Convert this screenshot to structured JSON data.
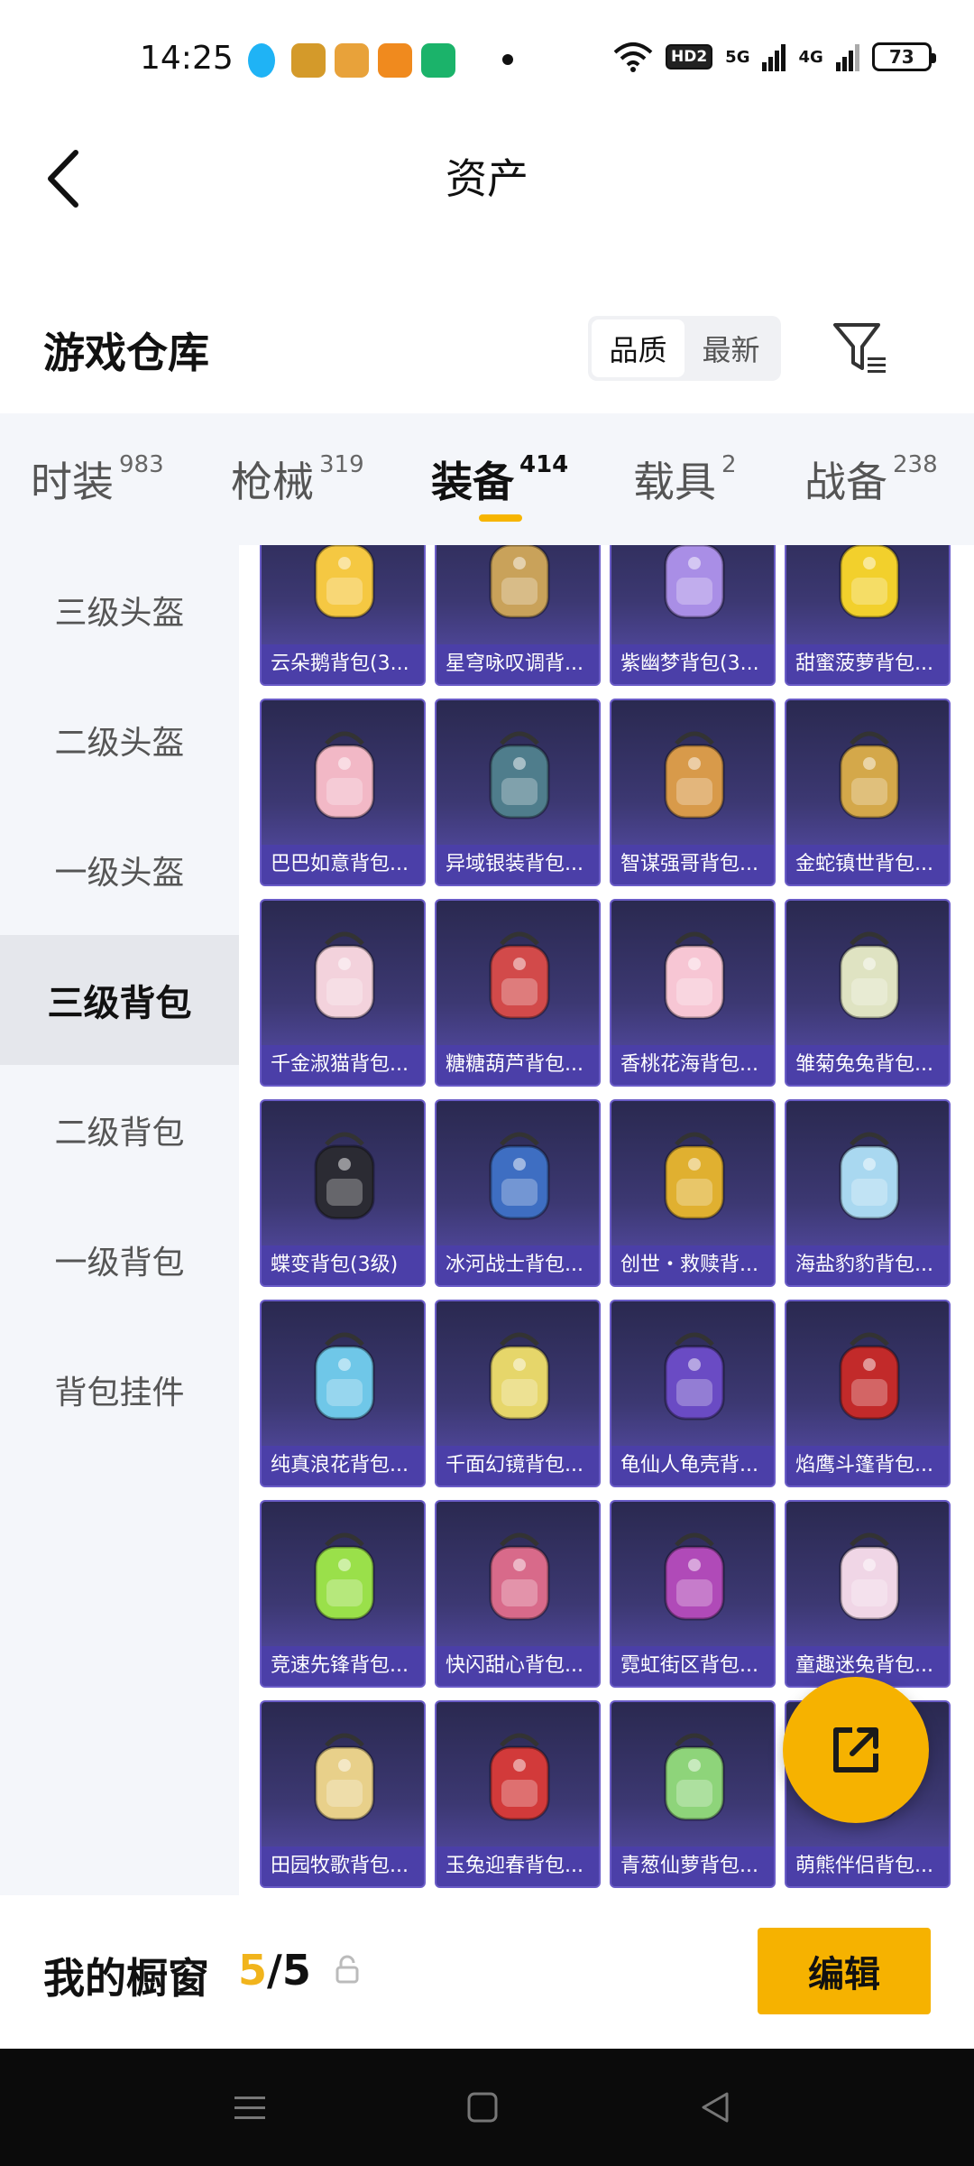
{
  "status_bar": {
    "time": "14:25",
    "hd_label": "HD2",
    "net1": "5G",
    "net2": "4G",
    "battery": "73"
  },
  "header": {
    "title": "资产"
  },
  "warehouse": {
    "title": "游戏仓库",
    "sort_options": [
      "品质",
      "最新"
    ],
    "active_sort": "品质"
  },
  "tabs": [
    {
      "label": "时装",
      "count": "983"
    },
    {
      "label": "枪械",
      "count": "319"
    },
    {
      "label": "装备",
      "count": "414"
    },
    {
      "label": "载具",
      "count": "2"
    },
    {
      "label": "战备",
      "count": "238"
    }
  ],
  "active_tab": "装备",
  "sidebar": {
    "items": [
      "三级头盔",
      "二级头盔",
      "一级头盔",
      "三级背包",
      "二级背包",
      "一级背包",
      "背包挂件"
    ],
    "active": "三级背包"
  },
  "items": [
    {
      "name": "云朵鹅背包(3...",
      "color": "#f5c842"
    },
    {
      "name": "星穹咏叹调背...",
      "color": "#c9a25a"
    },
    {
      "name": "紫幽梦背包(3...",
      "color": "#a98ee6"
    },
    {
      "name": "甜蜜菠萝背包...",
      "color": "#f2d02c"
    },
    {
      "name": "巴巴如意背包...",
      "color": "#f2b8c6"
    },
    {
      "name": "异域银装背包...",
      "color": "#4f7d8c"
    },
    {
      "name": "智谋强哥背包...",
      "color": "#d89a4a"
    },
    {
      "name": "金蛇镇世背包...",
      "color": "#d4a84a"
    },
    {
      "name": "千金淑猫背包...",
      "color": "#f3d2dc"
    },
    {
      "name": "糖糖葫芦背包...",
      "color": "#d24a4a"
    },
    {
      "name": "香桃花海背包...",
      "color": "#f7c6d4"
    },
    {
      "name": "雏菊兔兔背包...",
      "color": "#dfe3c2"
    },
    {
      "name": "蝶变背包(3级)",
      "color": "#2b2b33"
    },
    {
      "name": "冰河战士背包...",
      "color": "#3e6ec2"
    },
    {
      "name": "创世・救赎背...",
      "color": "#e0b030"
    },
    {
      "name": "海盐豹豹背包...",
      "color": "#a9d8f0"
    },
    {
      "name": "纯真浪花背包...",
      "color": "#6fc7e8"
    },
    {
      "name": "千面幻镜背包...",
      "color": "#e6d66a"
    },
    {
      "name": "龟仙人龟壳背...",
      "color": "#6a4bc4"
    },
    {
      "name": "焰鹰斗篷背包...",
      "color": "#c22a2a"
    },
    {
      "name": "竞速先锋背包...",
      "color": "#9ae04a"
    },
    {
      "name": "快闪甜心背包...",
      "color": "#d86a8a"
    },
    {
      "name": "霓虹街区背包...",
      "color": "#b04ab8"
    },
    {
      "name": "童趣迷兔背包...",
      "color": "#f0d6e6"
    },
    {
      "name": "田园牧歌背包...",
      "color": "#e8d08a"
    },
    {
      "name": "玉兔迎春背包...",
      "color": "#d23a3a"
    },
    {
      "name": "青葱仙萝背包...",
      "color": "#8ed47a"
    },
    {
      "name": "萌熊伴侣背包...",
      "color": "#f0c0c8"
    }
  ],
  "showcase": {
    "label": "我的橱窗",
    "current": "5",
    "separator": "/",
    "max": "5"
  },
  "edit_label": "编辑",
  "colors": {
    "accent": "#f6b200",
    "card_bg": "#3c3872",
    "card_label_bg": "#4b3fa8"
  }
}
